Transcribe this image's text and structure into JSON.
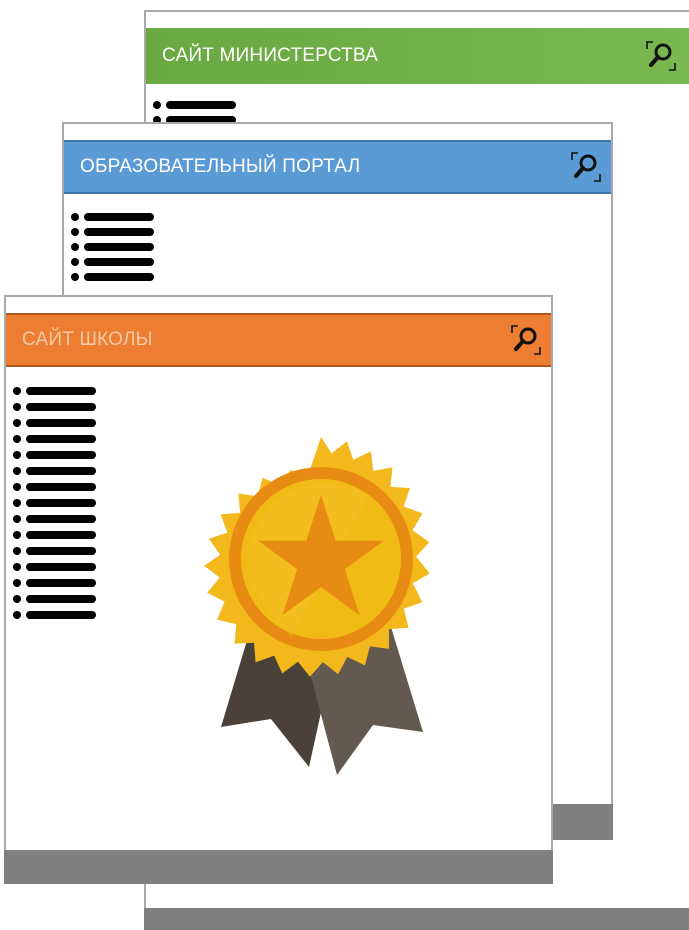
{
  "windows": {
    "ministry": {
      "title": "САЙТ МИНИСТЕРСТВА",
      "header_color": "#70ad47",
      "list_lines": 2
    },
    "portal": {
      "title": "ОБРАЗОВАТЕЛЬНЫЙ ПОРТАЛ",
      "header_color": "#5b9bd5",
      "list_lines": 5
    },
    "school": {
      "title": "САЙТ ШКОЛЫ",
      "header_color": "#ed7d31",
      "list_lines": 15
    }
  },
  "icons": {
    "search": "search-icon",
    "list": "bulleted-list-icon",
    "award": "award-medal-icon"
  },
  "colors": {
    "frame_border": "#a9a9a9",
    "footer_bar": "#7f7f7f",
    "medal_gold": "#f3b81c",
    "medal_orange": "#e78b12",
    "ribbon_dark": "#4a4239",
    "ribbon_light": "#625a4f"
  }
}
